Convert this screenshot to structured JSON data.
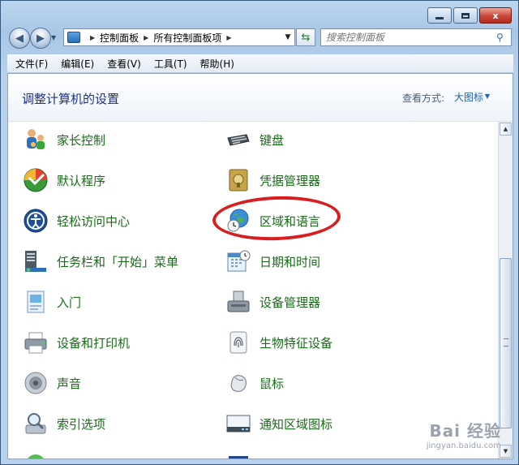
{
  "window": {
    "minimize": "",
    "maximize": "",
    "close": "x"
  },
  "nav": {
    "back": "◀",
    "forward": "▶",
    "breadcrumb": [
      "控制面板",
      "所有控制面板项"
    ],
    "search_placeholder": "搜索控制面板"
  },
  "menu": [
    "文件(F)",
    "编辑(E)",
    "查看(V)",
    "工具(T)",
    "帮助(H)"
  ],
  "header": {
    "title": "调整计算机的设置",
    "view_label": "查看方式:",
    "view_value": "大图标"
  },
  "items": {
    "left": [
      "家长控制",
      "默认程序",
      "轻松访问中心",
      "任务栏和「开始」菜单",
      "入门",
      "设备和打印机",
      "声音",
      "索引选项"
    ],
    "right": [
      "键盘",
      "凭据管理器",
      "区域和语言",
      "日期和时间",
      "设备管理器",
      "生物特征设备",
      "鼠标",
      "通知区域图标"
    ]
  },
  "watermark": {
    "line1": "Bai 经验",
    "line2": "jingyan.baidu.com"
  },
  "colors": {
    "link_green": "#1a6a1a",
    "title_blue": "#1e3287",
    "highlight_red": "#d81e1e"
  }
}
